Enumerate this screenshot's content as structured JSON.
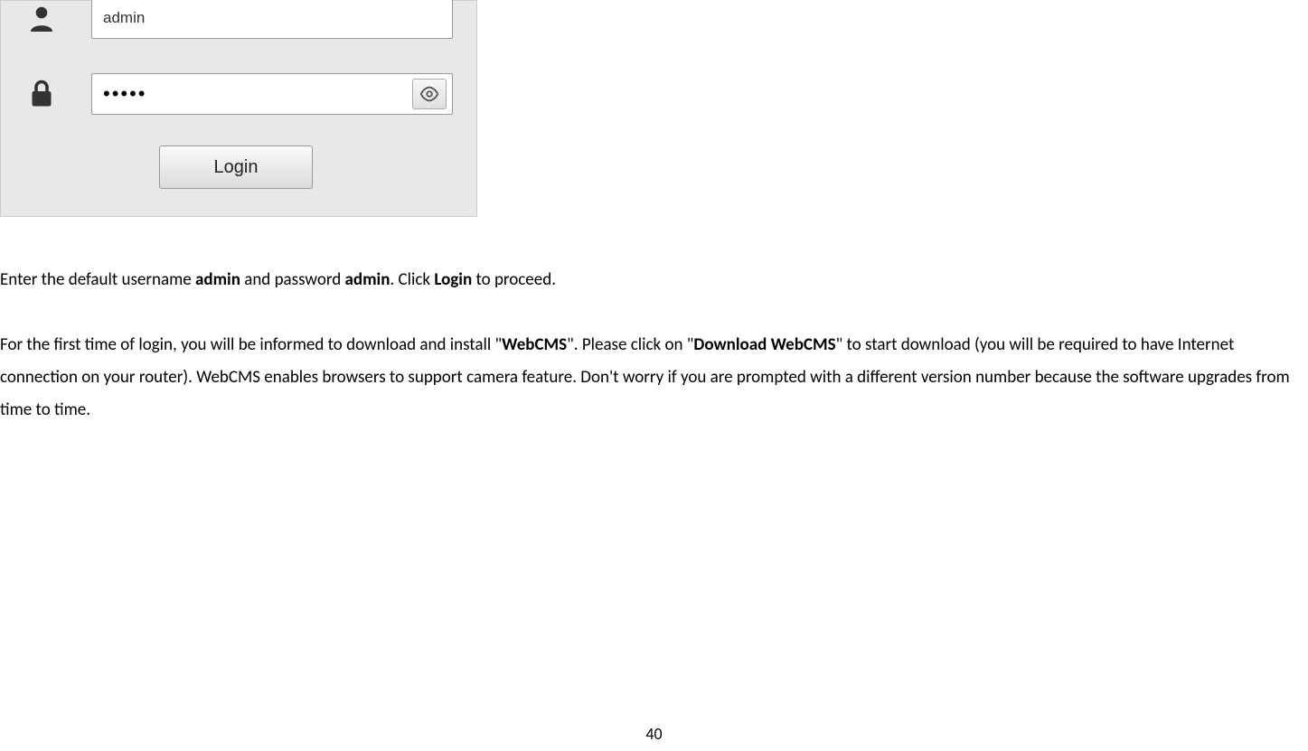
{
  "login": {
    "username_value": "admin",
    "password_masked": "•••••",
    "login_button": "Login"
  },
  "paragraph1": {
    "t1": "Enter the default username ",
    "b1": "admin",
    "t2": " and password ",
    "b2": "admin",
    "t3": ". Click ",
    "b3": "Login",
    "t4": " to proceed."
  },
  "paragraph2": {
    "t1": "For the first time of login, you will be informed to download and install \"",
    "b1": "WebCMS",
    "t2": "\". Please click on \"",
    "b2": "Download WebCMS",
    "t3": "\" to start download (you will be required to have Internet connection on your router). WebCMS enables browsers to support camera feature. Don't worry if you are prompted with a different version number because the software upgrades from time to time."
  },
  "page_number": "40"
}
